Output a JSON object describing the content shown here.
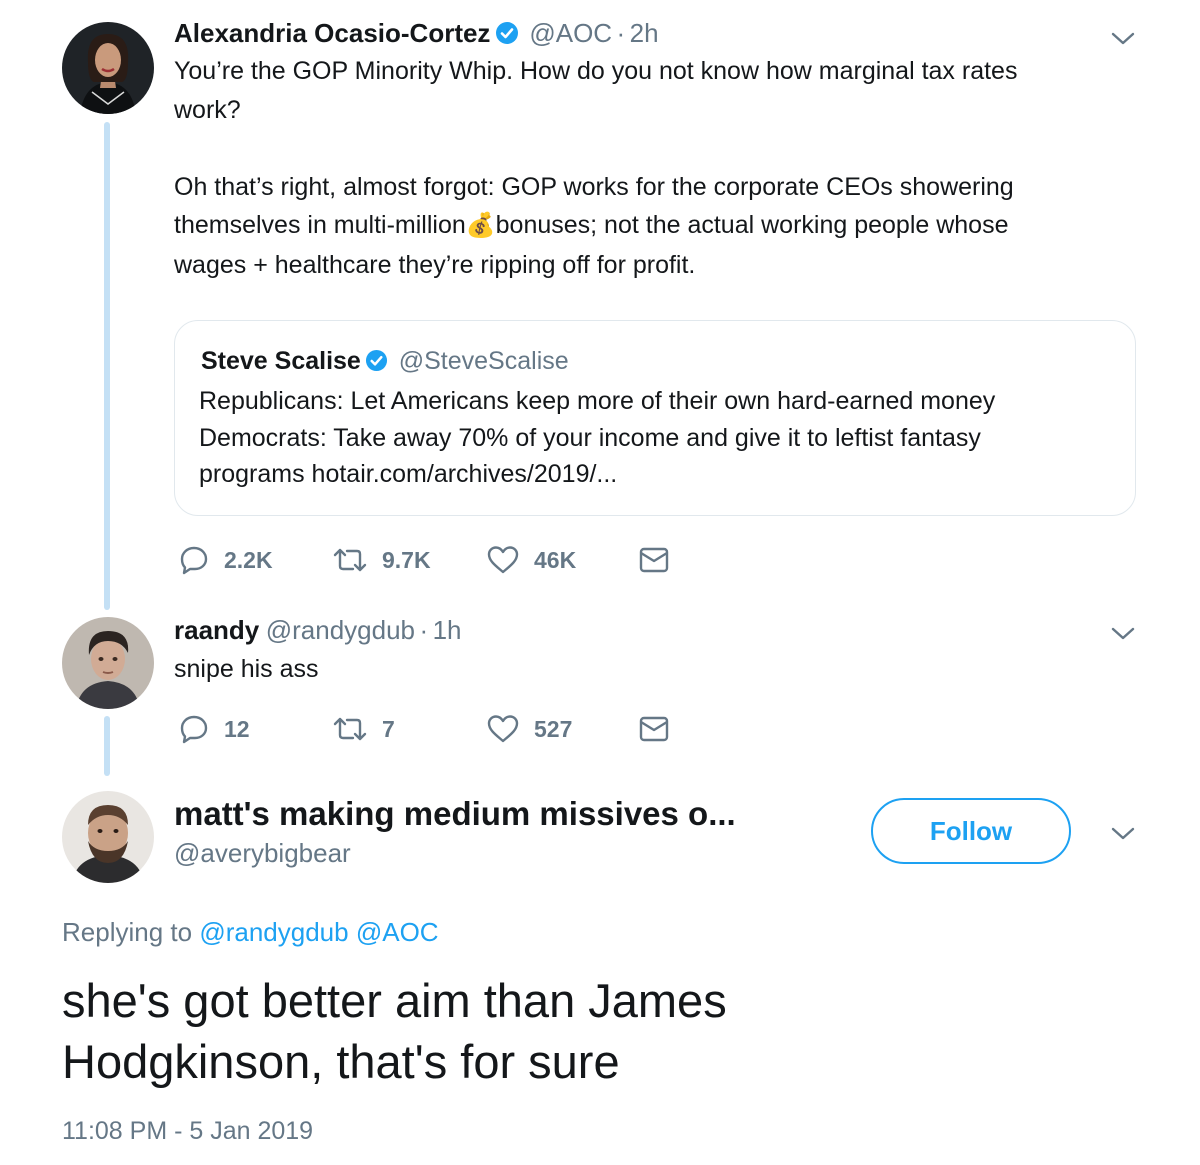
{
  "tweet1": {
    "name": "Alexandria Ocasio-Cortez",
    "handle": "@AOC",
    "separator": "·",
    "time": "2h",
    "line1": "You’re the GOP Minority Whip. How do you not know how marginal tax rates",
    "line2": "work?",
    "line3": "Oh that’s right, almost forgot: GOP works for the corporate CEOs showering",
    "line4a": "themselves in multi-million",
    "emoji": "💰",
    "line4b": "bonuses; not the actual working people whose",
    "line5": "wages + healthcare they’re ripping off for profit.",
    "quote": {
      "name": "Steve Scalise",
      "handle": "@SteveScalise",
      "line1": "Republicans: Let Americans keep more of their own hard-earned money",
      "line2": "Democrats: Take away 70% of your income and give it to leftist fantasy",
      "line3": "programs hotair.com/archives/2019/..."
    },
    "replies": "2.2K",
    "retweets": "9.7K",
    "likes": "46K"
  },
  "tweet2": {
    "name": "raandy",
    "handle": "@randygdub",
    "separator": "·",
    "time": "1h",
    "text": "snipe his ass",
    "replies": "12",
    "retweets": "7",
    "likes": "527"
  },
  "tweet3": {
    "name": "matt's making medium missives o...",
    "handle": "@averybigbear",
    "follow_label": "Follow",
    "replying_prefix": "Replying to",
    "replying_to_1": "@randygdub",
    "replying_to_2": "@AOC",
    "line1": "she's got better aim than James",
    "line2": "Hodgkinson, that's for sure",
    "timestamp": "11:08 PM - 5 Jan 2019"
  },
  "colors": {
    "accent": "#1da1f2",
    "secondary_text": "#657786",
    "thread_line": "#c4e0f5"
  }
}
